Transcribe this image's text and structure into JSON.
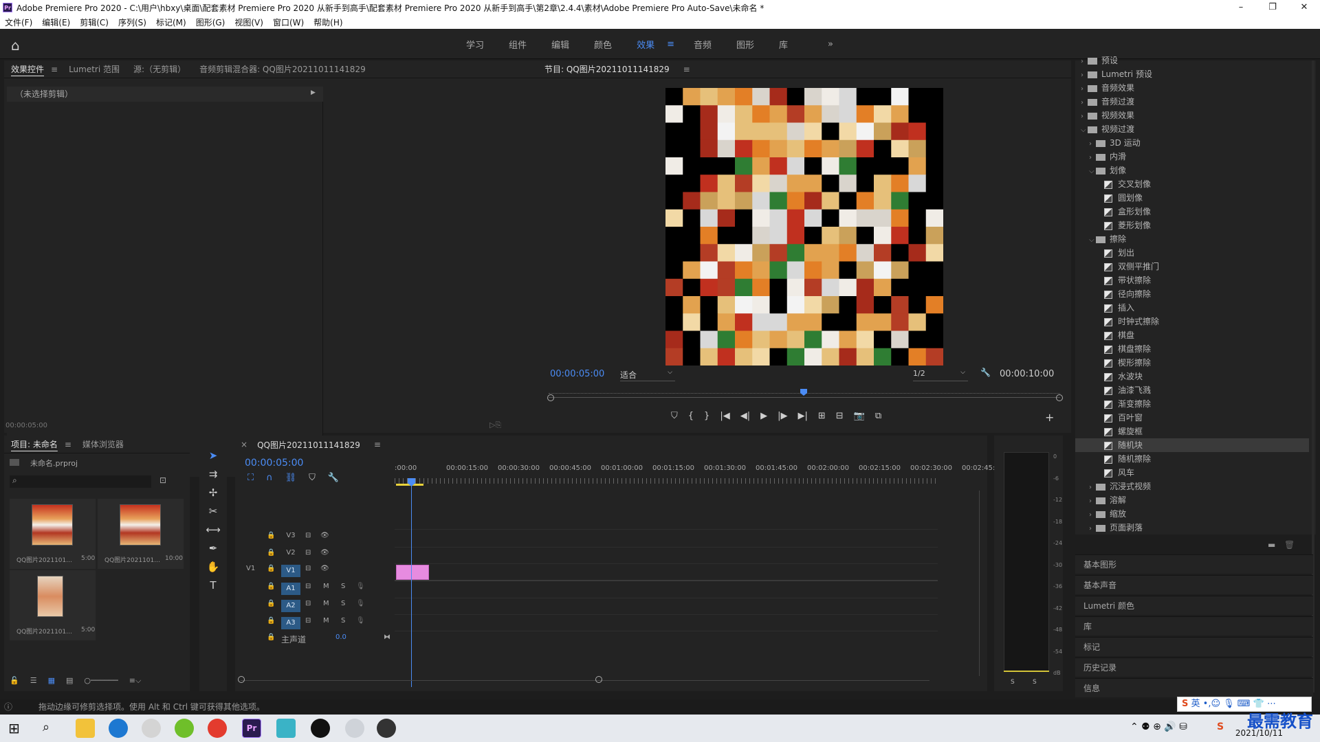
{
  "title_bar": {
    "text": "Adobe Premiere Pro 2020 - C:\\用户\\hbxy\\桌面\\配套素材 Premiere Pro 2020 从新手到高手\\配套素材 Premiere Pro 2020 从新手到高手\\第2章\\2.4.4\\素材\\Adobe Premiere Pro Auto-Save\\未命名 *"
  },
  "menu": [
    "文件(F)",
    "编辑(E)",
    "剪辑(C)",
    "序列(S)",
    "标记(M)",
    "图形(G)",
    "视图(V)",
    "窗口(W)",
    "帮助(H)"
  ],
  "workspaces": [
    "学习",
    "组件",
    "编辑",
    "颜色",
    "效果",
    "音频",
    "图形",
    "库"
  ],
  "active_workspace": "效果",
  "effect_controls": {
    "tabs": [
      "效果控件",
      "Lumetri 范围",
      "源:（无剪辑）",
      "音频剪辑混合器: QQ图片20211011141829"
    ],
    "no_clip": "（未选择剪辑）",
    "time": "00:00:05:00"
  },
  "program": {
    "title": "节目: QQ图片20211011141829",
    "current_time": "00:00:05:00",
    "fit": "适合",
    "quality": "1/2",
    "duration": "00:00:10:00"
  },
  "project": {
    "tabs": [
      "项目: 未命名",
      "媒体浏览器"
    ],
    "file": "未命名.prproj",
    "items": [
      {
        "name": "QQ图片2021101...",
        "dur": "5:00"
      },
      {
        "name": "QQ图片2021101...",
        "dur": "10:00"
      },
      {
        "name": "QQ图片2021101...",
        "dur": "5:00"
      }
    ]
  },
  "timeline": {
    "seq_name": "QQ图片20211011141829",
    "current_time": "00:00:05:00",
    "ruler": [
      ":00:00",
      "00:00:15:00",
      "00:00:30:00",
      "00:00:45:00",
      "00:01:00:00",
      "00:01:15:00",
      "00:01:30:00",
      "00:01:45:00",
      "00:02:00:00",
      "00:02:15:00",
      "00:02:30:00",
      "00:02:45:"
    ],
    "video_tracks": [
      "V3",
      "V2",
      "V1"
    ],
    "audio_tracks": [
      "A1",
      "A2",
      "A3"
    ],
    "source_patch": "V1",
    "master": "主声道",
    "master_val": "0.0",
    "m_label": "M",
    "s_label": "S"
  },
  "meter": {
    "scale": [
      "0",
      "-6",
      "-12",
      "-18",
      "-24",
      "-30",
      "-36",
      "-42",
      "-48",
      "-54",
      "dB"
    ],
    "solo": [
      "S",
      "S"
    ]
  },
  "effects_tree": [
    {
      "l": 0,
      "t": "folder",
      "txt": "预设",
      "open": false
    },
    {
      "l": 0,
      "t": "folder",
      "txt": "Lumetri 预设",
      "open": false
    },
    {
      "l": 0,
      "t": "folder",
      "txt": "音频效果",
      "open": false
    },
    {
      "l": 0,
      "t": "folder",
      "txt": "音频过渡",
      "open": false
    },
    {
      "l": 0,
      "t": "folder",
      "txt": "视频效果",
      "open": false
    },
    {
      "l": 0,
      "t": "folder",
      "txt": "视频过渡",
      "open": true
    },
    {
      "l": 1,
      "t": "folder",
      "txt": "3D 运动",
      "open": false
    },
    {
      "l": 1,
      "t": "folder",
      "txt": "内滑",
      "open": false
    },
    {
      "l": 1,
      "t": "folder",
      "txt": "划像",
      "open": true
    },
    {
      "l": 2,
      "t": "fx",
      "txt": "交叉划像"
    },
    {
      "l": 2,
      "t": "fx",
      "txt": "圆划像"
    },
    {
      "l": 2,
      "t": "fx",
      "txt": "盒形划像"
    },
    {
      "l": 2,
      "t": "fx",
      "txt": "菱形划像"
    },
    {
      "l": 1,
      "t": "folder",
      "txt": "擦除",
      "open": true
    },
    {
      "l": 2,
      "t": "fx",
      "txt": "划出"
    },
    {
      "l": 2,
      "t": "fx",
      "txt": "双侧平推门"
    },
    {
      "l": 2,
      "t": "fx",
      "txt": "带状擦除"
    },
    {
      "l": 2,
      "t": "fx",
      "txt": "径向擦除"
    },
    {
      "l": 2,
      "t": "fx",
      "txt": "插入"
    },
    {
      "l": 2,
      "t": "fx",
      "txt": "时钟式擦除"
    },
    {
      "l": 2,
      "t": "fx",
      "txt": "棋盘"
    },
    {
      "l": 2,
      "t": "fx",
      "txt": "棋盘擦除"
    },
    {
      "l": 2,
      "t": "fx",
      "txt": "楔形擦除"
    },
    {
      "l": 2,
      "t": "fx",
      "txt": "水波块"
    },
    {
      "l": 2,
      "t": "fx",
      "txt": "油漆飞溅"
    },
    {
      "l": 2,
      "t": "fx",
      "txt": "渐变擦除"
    },
    {
      "l": 2,
      "t": "fx",
      "txt": "百叶窗"
    },
    {
      "l": 2,
      "t": "fx",
      "txt": "螺旋框"
    },
    {
      "l": 2,
      "t": "fx",
      "txt": "随机块",
      "sel": true
    },
    {
      "l": 2,
      "t": "fx",
      "txt": "随机擦除"
    },
    {
      "l": 2,
      "t": "fx",
      "txt": "风车"
    },
    {
      "l": 1,
      "t": "folder",
      "txt": "沉浸式视频",
      "open": false
    },
    {
      "l": 1,
      "t": "folder",
      "txt": "溶解",
      "open": false
    },
    {
      "l": 1,
      "t": "folder",
      "txt": "缩放",
      "open": false
    },
    {
      "l": 1,
      "t": "folder",
      "txt": "页面剥落",
      "open": false
    }
  ],
  "collapsed_panels": [
    "基本图形",
    "基本声音",
    "Lumetri 颜色",
    "库",
    "标记",
    "历史记录",
    "信息"
  ],
  "status": "拖动边缘可修剪选择项。使用 Alt 和 Ctrl 键可获得其他选项。",
  "taskbar": {
    "ime": "英",
    "time": "",
    "date": "2021/10/11"
  },
  "brand": "最需教育"
}
